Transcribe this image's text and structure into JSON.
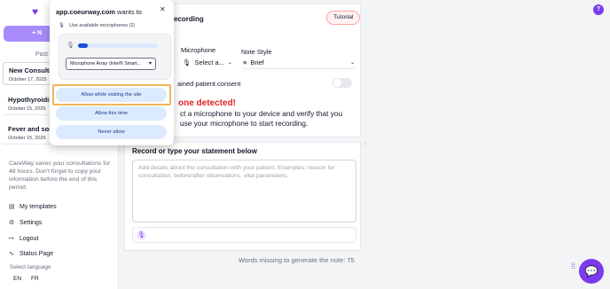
{
  "sidebar": {
    "logo": "♥",
    "new_button": "+ N",
    "past_label": "Past",
    "consultations": [
      {
        "title": "New Consultat",
        "date": "October 17, 2025"
      },
      {
        "title": "Hypothyroidis",
        "date": "October 15, 2025"
      },
      {
        "title": "Fever and sore",
        "date": "October 15, 2025"
      }
    ],
    "retention_note": "CareWay saves your consultations for 48 hours. Don't forget to copy your information before the end of this period.",
    "nav": {
      "templates": "My templates",
      "settings": "Settings",
      "logout": "Logout",
      "status": "Status Page"
    },
    "select_language": "Select language",
    "languages": [
      "EN",
      "FR"
    ]
  },
  "recording": {
    "title": "ecording",
    "tutorial": "Tutorial",
    "microphone_label": "Microphone",
    "microphone_value": "Select a...",
    "note_style_label": "Note Style",
    "note_style_value": "Brief",
    "consent": "ained patient consent",
    "warning_title": "one detected!",
    "warning_text_1": "ct a microphone to your device and verify that you",
    "warning_text_2": "use your microphone to start recording."
  },
  "statement": {
    "title": "Record or type your statement below",
    "placeholder": "Add details about the consultation with your patient. Examples: reason for consultation, before/after observations, vital parameters.",
    "words_missing": "Words missing to generate the note: 75"
  },
  "popup": {
    "site": "app.coeurway.com",
    "wants_to": " wants to",
    "use_mics": "Use available microphones (2)",
    "mic_level": 0.12,
    "mic_device": "Microphone Array (Intel® Smart...",
    "allow_while": "Allow while visiting the site",
    "allow_once": "Allow this time",
    "never": "Never allow"
  },
  "help": "?",
  "colors": {
    "accent": "#7c3aed",
    "warning": "#dc2626",
    "highlight": "#f0b557"
  }
}
